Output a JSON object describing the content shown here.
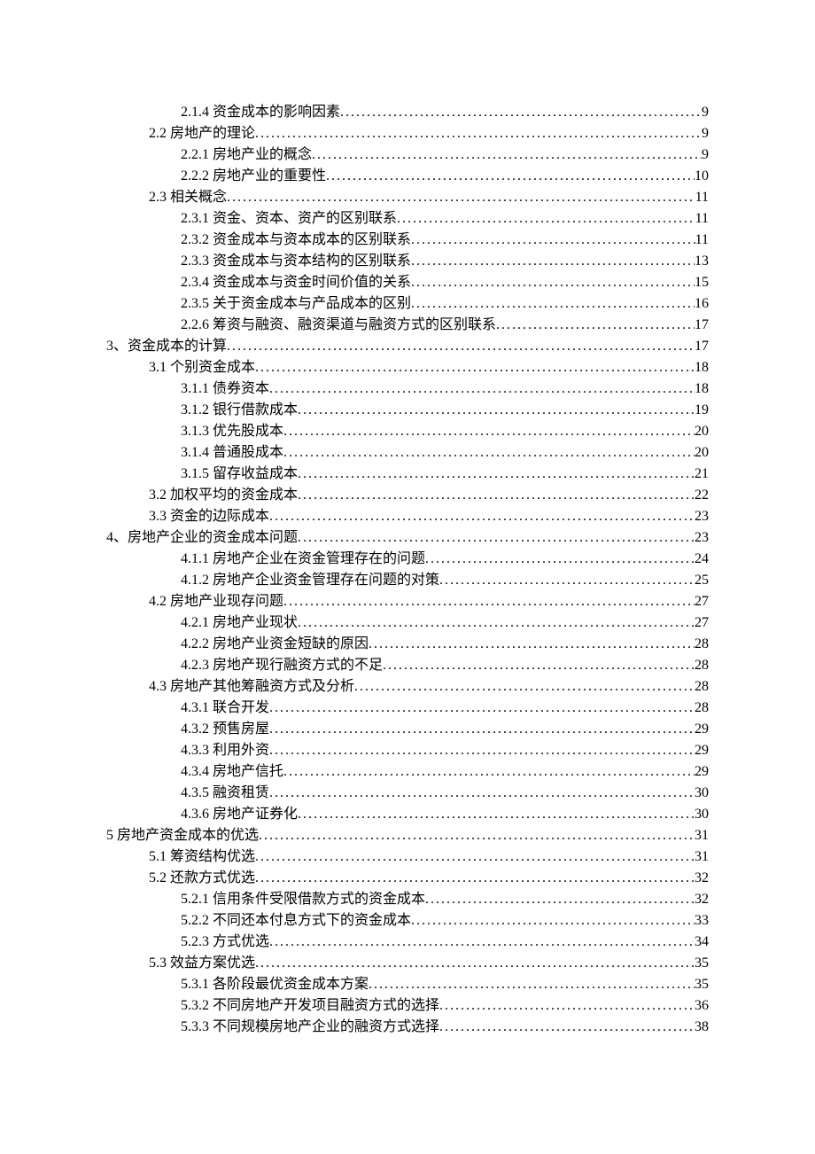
{
  "toc": [
    {
      "level": 3,
      "title": "2.1.4 资金成本的影响因素",
      "page": "9"
    },
    {
      "level": 2,
      "title": "2.2 房地产的理论",
      "page": "9"
    },
    {
      "level": 3,
      "title": "2.2.1 房地产业的概念",
      "page": "9"
    },
    {
      "level": 3,
      "title": "2.2.2 房地产业的重要性",
      "page": "10"
    },
    {
      "level": 2,
      "title": "2.3 相关概念",
      "page": "11"
    },
    {
      "level": 3,
      "title": "2.3.1 资金、资本、资产的区别联系",
      "page": "11"
    },
    {
      "level": 3,
      "title": "2.3.2 资金成本与资本成本的区别联系",
      "page": "11"
    },
    {
      "level": 3,
      "title": "2.3.3  资金成本与资本结构的区别联系",
      "page": "13"
    },
    {
      "level": 3,
      "title": "2.3.4 资金成本与资金时间价值的关系",
      "page": "15"
    },
    {
      "level": 3,
      "title": "2.3.5 关于资金成本与产品成本的区别",
      "page": "16"
    },
    {
      "level": 3,
      "title": "2.2.6 筹资与融资、融资渠道与融资方式的区别联系",
      "page": "17"
    },
    {
      "level": 1,
      "title": "3、资金成本的计算",
      "page": "17"
    },
    {
      "level": 2,
      "title": "3.1 个别资金成本",
      "page": "18"
    },
    {
      "level": 3,
      "title": "3.1.1 债券资本",
      "page": "18"
    },
    {
      "level": 3,
      "title": "3.1.2 银行借款成本",
      "page": "19"
    },
    {
      "level": 3,
      "title": "3.1.3 优先股成本",
      "page": "20"
    },
    {
      "level": 3,
      "title": "3.1.4 普通股成本",
      "page": "20"
    },
    {
      "level": 3,
      "title": "3.1.5 留存收益成本",
      "page": "21"
    },
    {
      "level": 2,
      "title": "3.2 加权平均的资金成本",
      "page": "22"
    },
    {
      "level": 2,
      "title": "3.3 资金的边际成本",
      "page": "23"
    },
    {
      "level": 1,
      "title": "4、房地产企业的资金成本问题",
      "page": "23"
    },
    {
      "level": 3,
      "title": "4.1.1 房地产企业在资金管理存在的问题",
      "page": "24"
    },
    {
      "level": 3,
      "title": "4.1.2 房地产企业资金管理存在问题的对策",
      "page": "25"
    },
    {
      "level": 2,
      "title": "4.2 房地产业现存问题",
      "page": "27"
    },
    {
      "level": 3,
      "title": "4.2.1 房地产业现状",
      "page": "27"
    },
    {
      "level": 3,
      "title": "4.2.2 房地产业资金短缺的原因",
      "page": "28"
    },
    {
      "level": 3,
      "title": "4.2.3 房地产现行融资方式的不足",
      "page": "28"
    },
    {
      "level": 2,
      "title": "4.3 房地产其他筹融资方式及分析",
      "page": "28"
    },
    {
      "level": 3,
      "title": "4.3.1  联合开发",
      "page": "28"
    },
    {
      "level": 3,
      "title": "4.3.2 预售房屋",
      "page": "29"
    },
    {
      "level": 3,
      "title": "4.3.3 利用外资",
      "page": "29"
    },
    {
      "level": 3,
      "title": "4.3.4 房地产信托",
      "page": "29"
    },
    {
      "level": 3,
      "title": "4.3.5 融资租赁",
      "page": "30"
    },
    {
      "level": 3,
      "title": "4.3.6 房地产证券化",
      "page": "30"
    },
    {
      "level": 1,
      "title": "5 房地产资金成本的优选",
      "page": "31"
    },
    {
      "level": 2,
      "title": "5.1 筹资结构优选",
      "page": "31"
    },
    {
      "level": 2,
      "title": "5.2 还款方式优选",
      "page": "32"
    },
    {
      "level": 3,
      "title": "5.2.1 信用条件受限借款方式的资金成本",
      "page": "32"
    },
    {
      "level": 3,
      "title": "5.2.2 不同还本付息方式下的资金成本",
      "page": "33"
    },
    {
      "level": 3,
      "title": "5.2.3 方式优选",
      "page": "34"
    },
    {
      "level": 2,
      "title": "5.3 效益方案优选",
      "page": "35"
    },
    {
      "level": 3,
      "title": "5.3.1 各阶段最优资金成本方案",
      "page": "35"
    },
    {
      "level": 3,
      "title": "5.3.2 不同房地产开发项目融资方式的选择",
      "page": "36"
    },
    {
      "level": 3,
      "title": "5.3.3 不同规模房地产企业的融资方式选择",
      "page": "38"
    }
  ]
}
